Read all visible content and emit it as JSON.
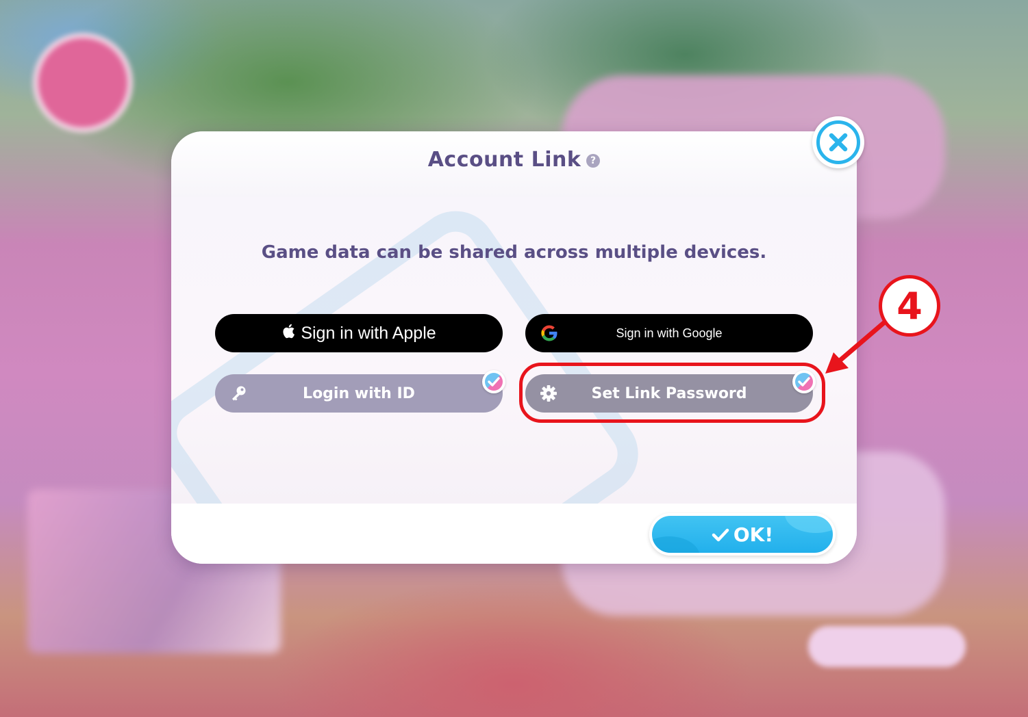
{
  "dialog": {
    "title": "Account Link",
    "help_icon": "question-icon",
    "subtitle": "Game data can be shared across multiple devices."
  },
  "buttons": {
    "apple": {
      "label": "Sign in with Apple",
      "icon": "apple-icon"
    },
    "google": {
      "label": "Sign in with Google",
      "icon": "google-icon"
    },
    "login_id": {
      "label": "Login with ID",
      "icon": "key-icon",
      "linked": true
    },
    "set_password": {
      "label": "Set Link Password",
      "icon": "gear-icon",
      "linked": true
    }
  },
  "ok_button": {
    "label": "OK!",
    "icon": "checkmark-icon"
  },
  "close_button": {
    "icon": "close-icon"
  },
  "annotation": {
    "step_number": "4",
    "highlight_color": "#e8141c"
  },
  "colors": {
    "title": "#5a4f85",
    "accent_blue": "#2ab4ec",
    "badge_pink": "#ef72b3",
    "login_button": "#a29db8",
    "set_password_button": "#9591a3"
  }
}
